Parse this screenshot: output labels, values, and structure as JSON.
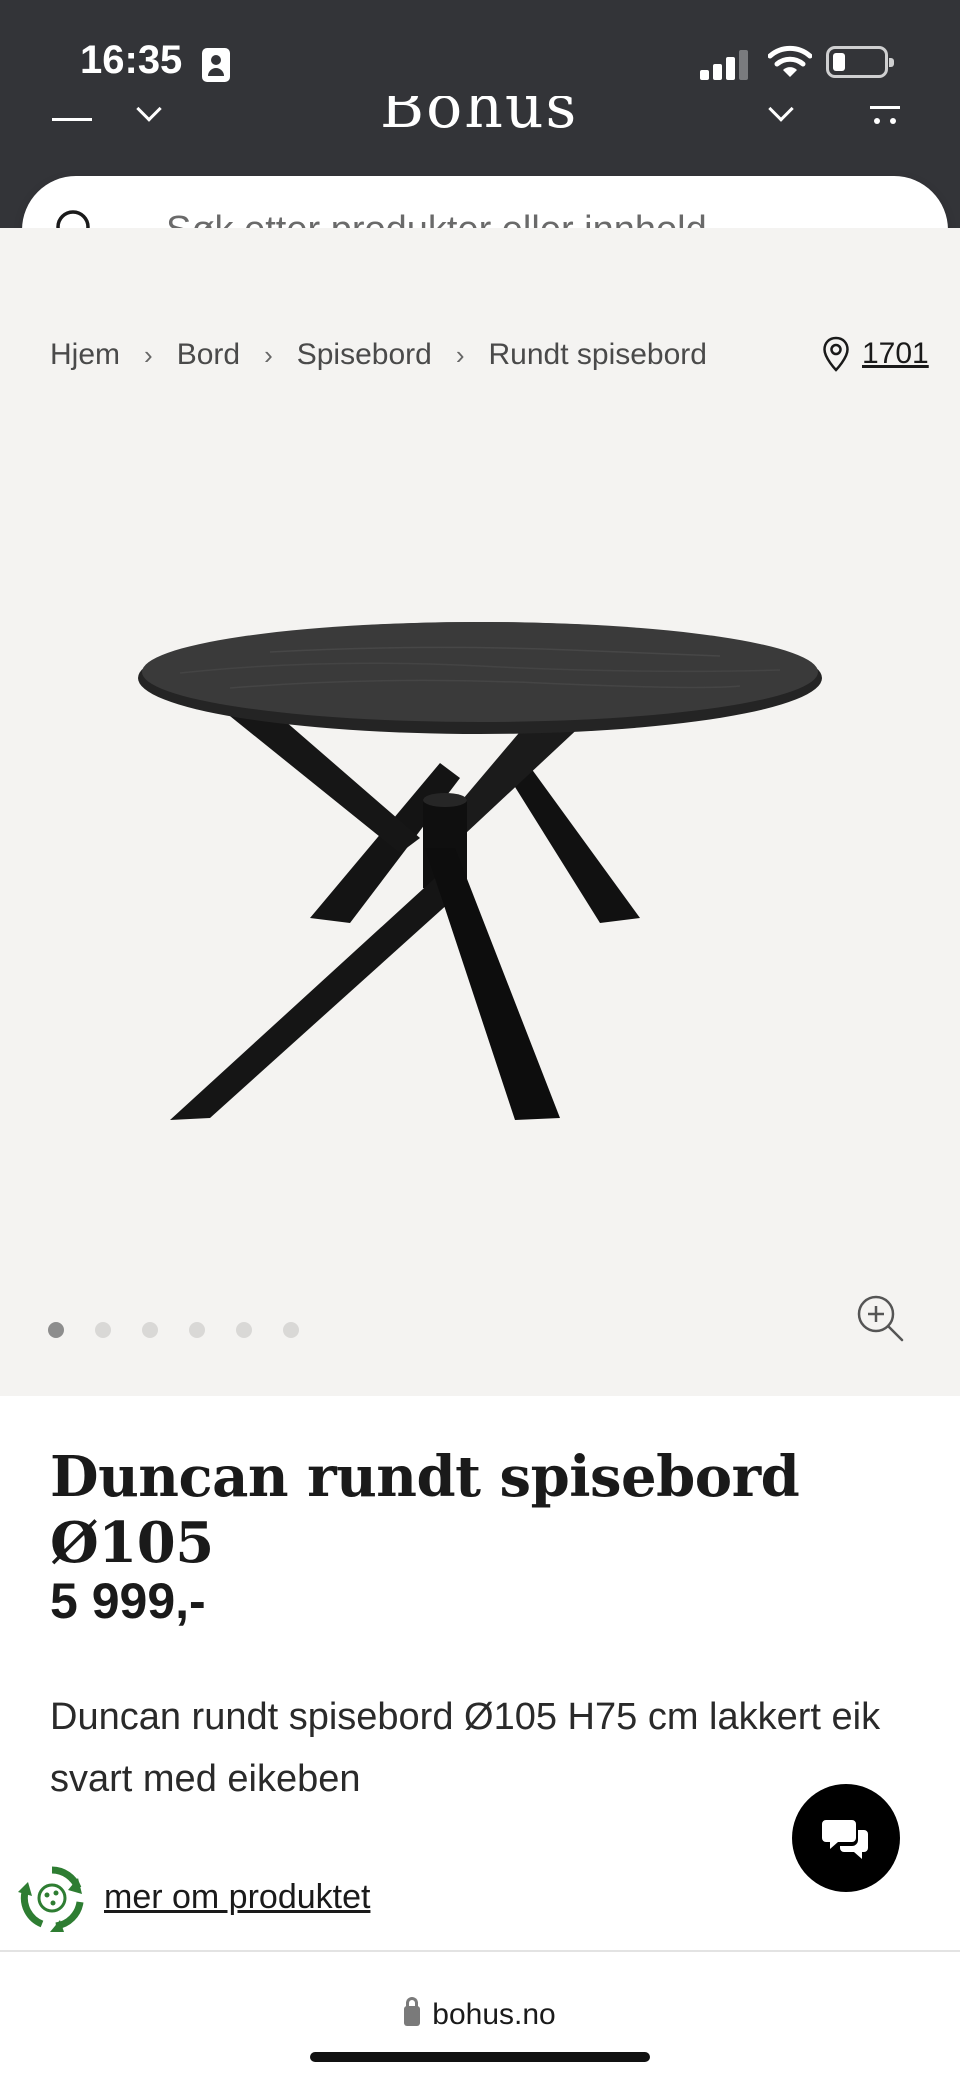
{
  "status_bar": {
    "time": "16:35"
  },
  "header": {
    "logo": "Bohus"
  },
  "search": {
    "placeholder": "Søk etter produkter eller innhold..."
  },
  "breadcrumb": {
    "items": [
      "Hjem",
      "Bord",
      "Spisebord",
      "Rundt spisebord"
    ],
    "separator": "›"
  },
  "store": {
    "label": "1701"
  },
  "gallery": {
    "image_count": 6,
    "active_index": 0
  },
  "product": {
    "title": "Duncan rundt spisebord Ø105",
    "price": "5 999,-",
    "description": "Duncan rundt spisebord Ø105 H75 cm lakkert eik svart med eikeben",
    "more_link": "mer om produktet"
  },
  "browser": {
    "url": "bohus.no"
  },
  "colors": {
    "header_bg": "#333438",
    "gallery_bg": "#f4f3f1",
    "eco_green": "#2e7d32",
    "chat_bg": "#000000"
  }
}
